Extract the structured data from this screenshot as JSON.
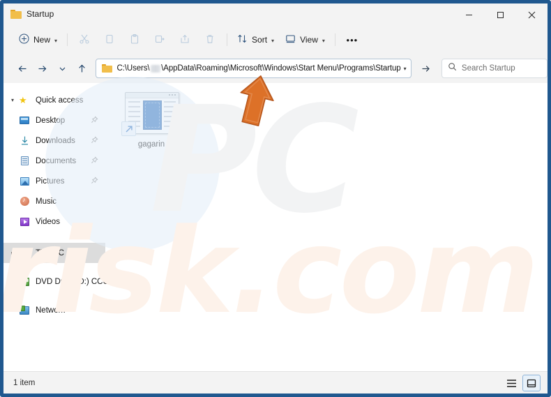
{
  "window": {
    "title": "Startup",
    "title_icon": "folder-icon",
    "minimize_label": "–",
    "maximize_label": "□",
    "close_label": "×"
  },
  "toolbar": {
    "new_label": "New",
    "new_icon": "plus-circle-icon",
    "items": [
      {
        "name": "cut",
        "icon": "scissors-icon",
        "enabled": false
      },
      {
        "name": "copy",
        "icon": "copy-icon",
        "enabled": false
      },
      {
        "name": "paste",
        "icon": "clipboard-icon",
        "enabled": false
      },
      {
        "name": "rename",
        "icon": "rename-icon",
        "enabled": false
      },
      {
        "name": "share",
        "icon": "share-icon",
        "enabled": false
      },
      {
        "name": "delete",
        "icon": "trash-icon",
        "enabled": false
      }
    ],
    "sort_label": "Sort",
    "sort_icon": "sort-arrows-icon",
    "view_label": "View",
    "view_icon": "monitor-icon",
    "more_label": "•••"
  },
  "address": {
    "back_icon": "arrow-left-icon",
    "forward_icon": "arrow-right-icon",
    "recent_icon": "chevron-down-icon",
    "up_icon": "arrow-up-icon",
    "folder_icon": "folder-icon",
    "path_prefix": "C:\\Users\\",
    "path_suffix": "\\AppData\\Roaming\\Microsoft\\Windows\\Start Menu\\Programs\\Startup",
    "path_full": "C:\\Users\\[username]\\AppData\\Roaming\\Microsoft\\Windows\\Start Menu\\Programs\\Startup",
    "dropdown_icon": "chevron-down-icon",
    "go_icon": "arrow-right-icon"
  },
  "search": {
    "placeholder": "Search Startup",
    "icon": "search-icon"
  },
  "sidebar": {
    "items": [
      {
        "label": "Quick access",
        "icon": "star-icon",
        "expander": "⌄",
        "expanded": true,
        "pinned": false,
        "indent": false,
        "selected": false
      },
      {
        "label": "Desktop",
        "icon": "desktop-icon",
        "expander": "",
        "pinned": true,
        "indent": true,
        "selected": false
      },
      {
        "label": "Downloads",
        "icon": "download-icon",
        "expander": "",
        "pinned": true,
        "indent": true,
        "selected": false
      },
      {
        "label": "Documents",
        "icon": "documents-icon",
        "expander": "",
        "pinned": true,
        "indent": true,
        "selected": false
      },
      {
        "label": "Pictures",
        "icon": "pictures-icon",
        "expander": "",
        "pinned": true,
        "indent": true,
        "selected": false
      },
      {
        "label": "Music",
        "icon": "music-icon",
        "expander": "",
        "pinned": false,
        "indent": true,
        "selected": false
      },
      {
        "label": "Videos",
        "icon": "videos-icon",
        "expander": "",
        "pinned": false,
        "indent": true,
        "selected": false
      },
      {
        "label": "This PC",
        "icon": "this-pc-icon",
        "expander": "›",
        "pinned": false,
        "indent": false,
        "selected": true
      },
      {
        "label": "DVD Drive (D:) CCCC",
        "icon": "dvd-drive-icon",
        "expander": "›",
        "pinned": false,
        "indent": false,
        "selected": false
      },
      {
        "label": "Network",
        "icon": "network-icon",
        "expander": "›",
        "pinned": false,
        "indent": false,
        "selected": false
      }
    ],
    "pin_glyph": "📌"
  },
  "files": [
    {
      "name": "gagarin",
      "icon": "shortcut-application-icon",
      "is_shortcut": true
    }
  ],
  "status": {
    "item_count_label": "1 item",
    "view_list_icon": "list-view-icon",
    "view_icons_icon": "large-icons-view-icon",
    "active_view": "large-icons-view-icon"
  },
  "watermark": {
    "primary": "PC",
    "secondary": "risk.com"
  },
  "annotation": {
    "arrow_icon": "orange-pointer-arrow",
    "color": "#DD7128"
  },
  "colors": {
    "window_border": "#20588f",
    "chrome": "#f3f3f3",
    "content": "#ffffff",
    "selection": "#dcdcdc",
    "accent_blue": "#2f72bf",
    "annotation_orange": "#DD7128"
  }
}
